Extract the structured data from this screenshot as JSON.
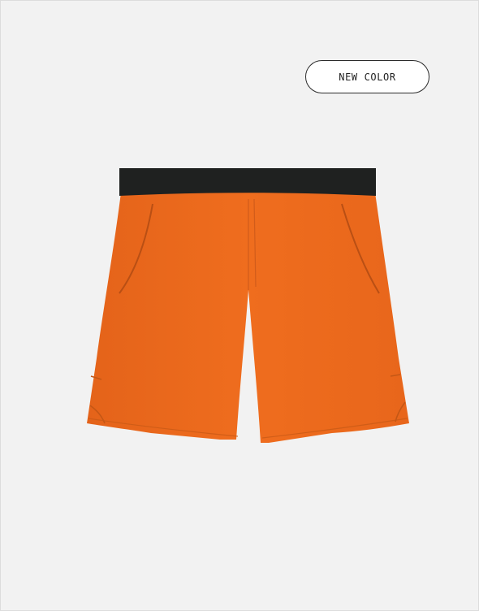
{
  "product_card": {
    "badge_label": "NEW COLOR",
    "image": {
      "subject": "shorts",
      "waistband_color": "#1f2120",
      "fabric_color": "#ec6a1b",
      "background_color": "#f2f2f2"
    }
  }
}
